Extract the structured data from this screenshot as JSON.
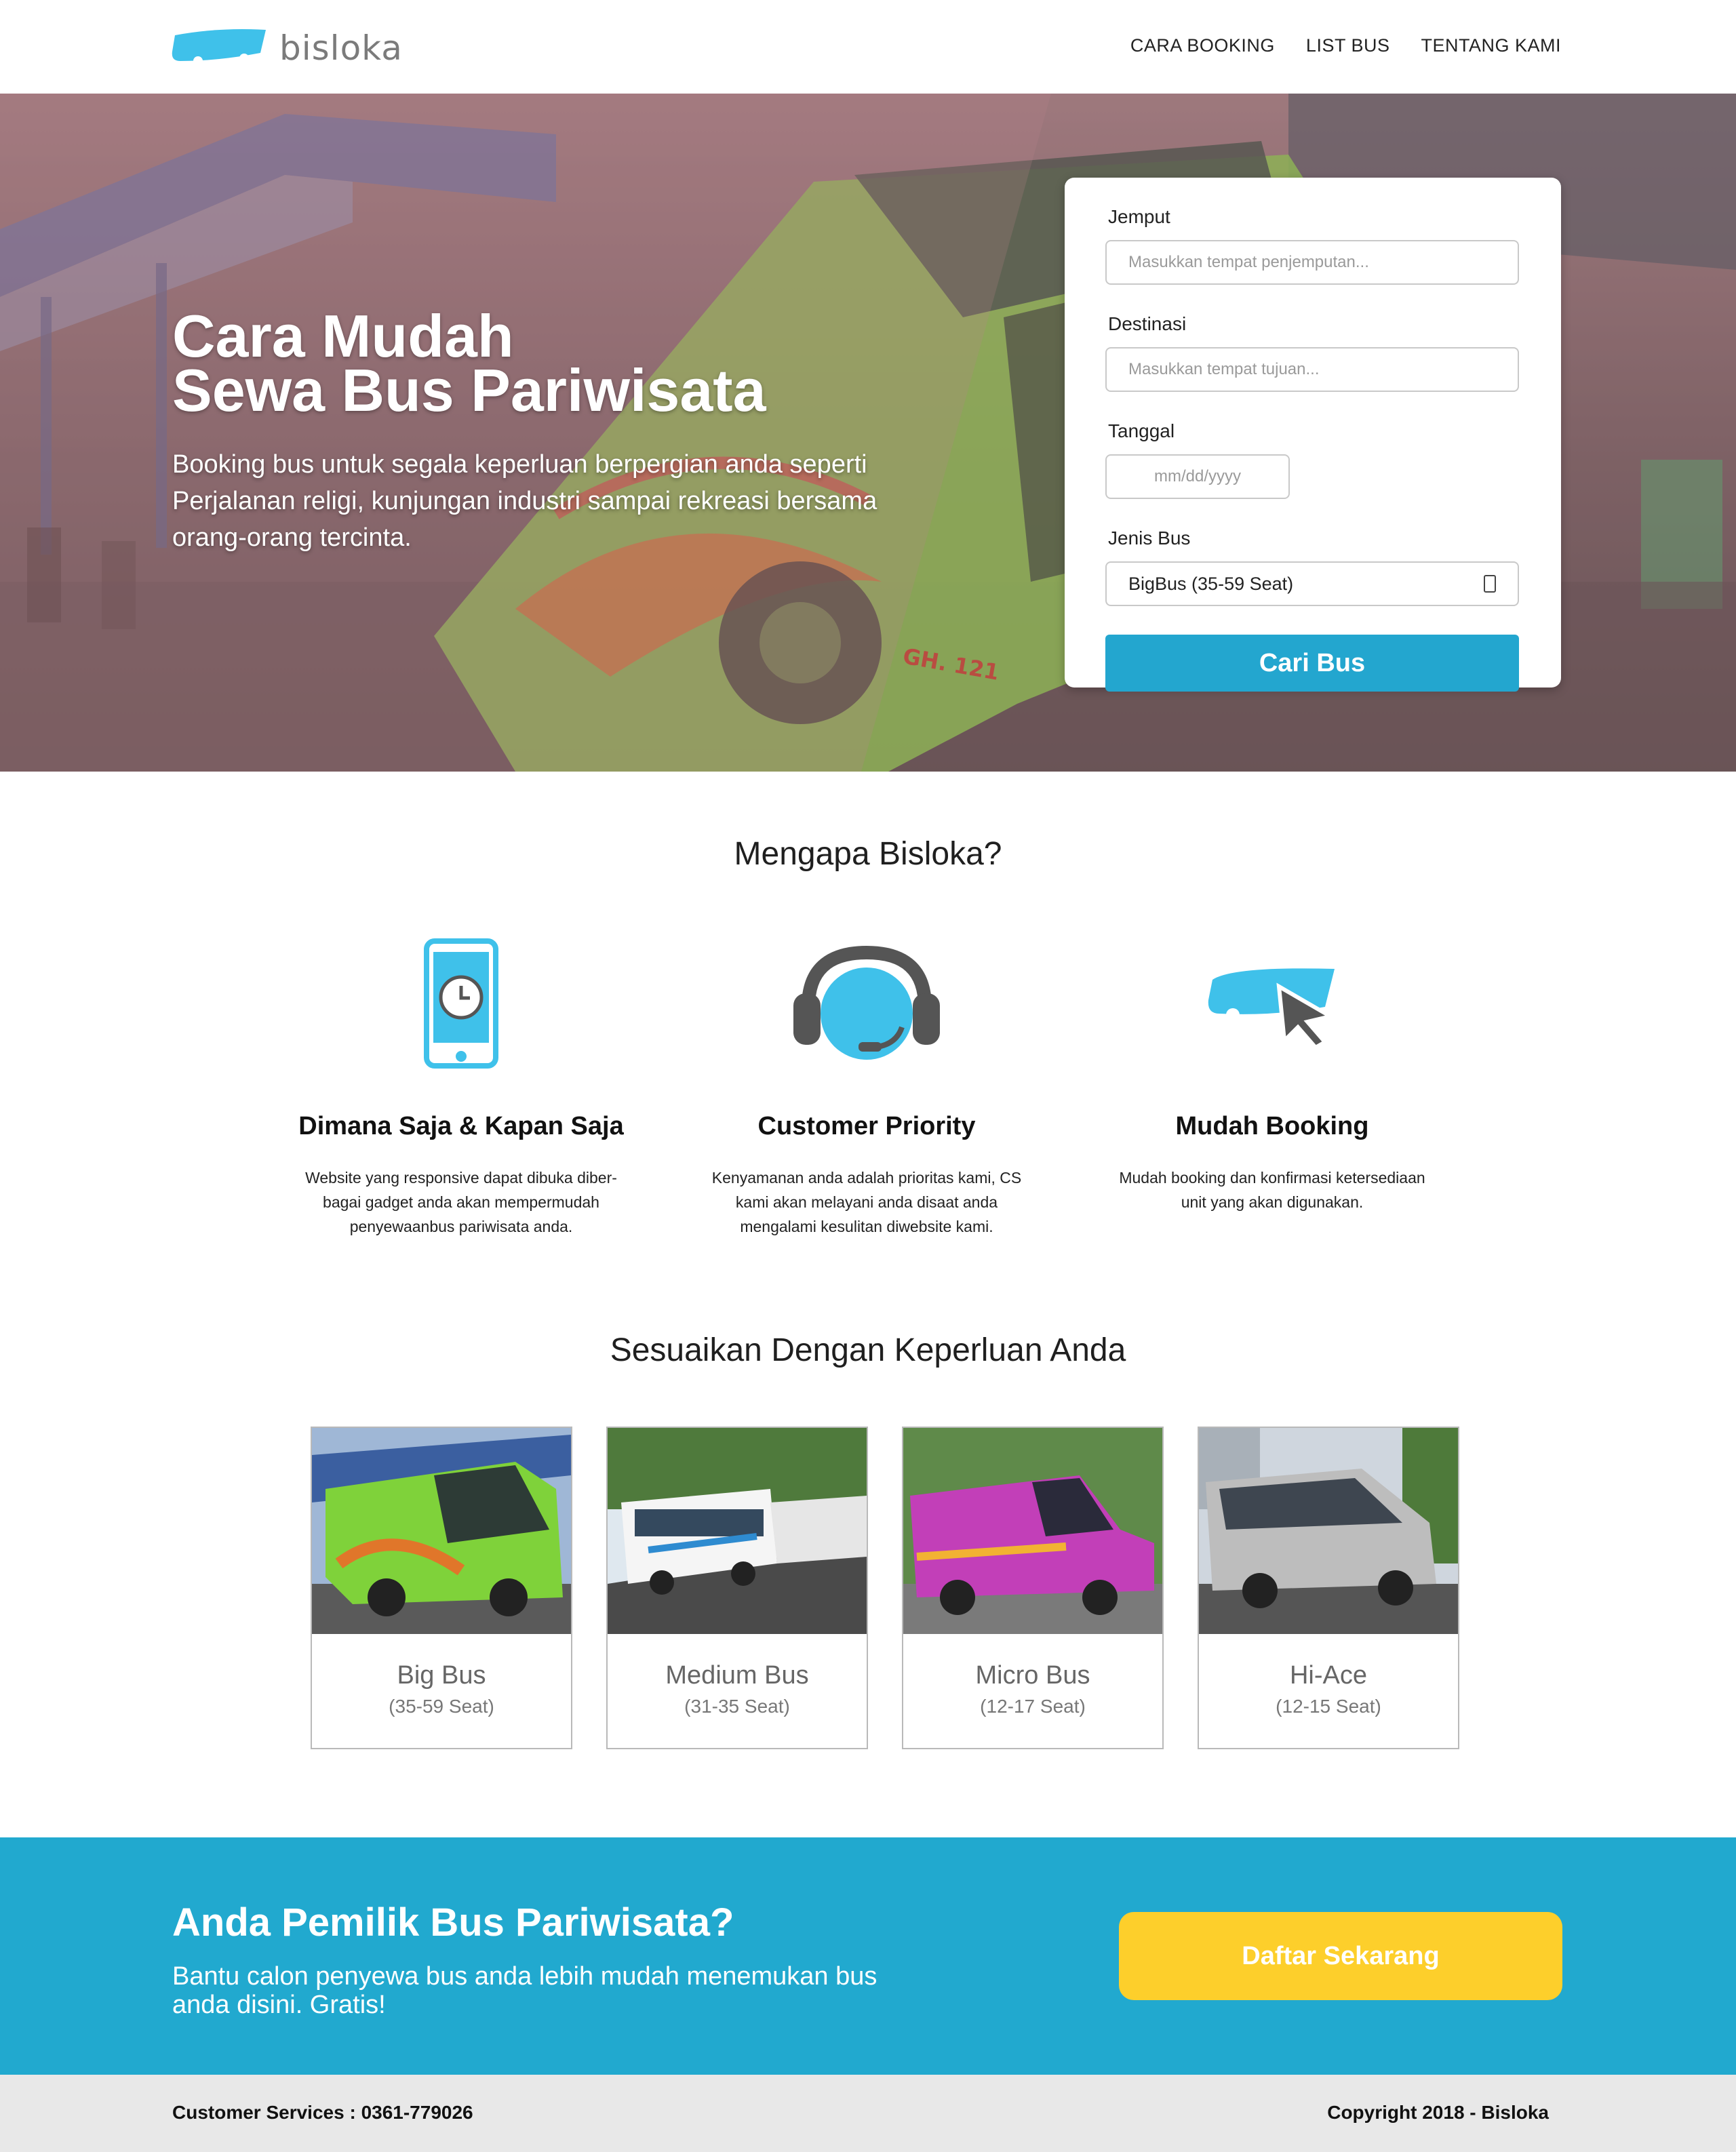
{
  "nav": {
    "logo_text": "bisloka",
    "links": [
      "CARA  BOOKING",
      "LIST BUS",
      "TENTANG KAMI"
    ]
  },
  "hero": {
    "title_line1": "Cara Mudah",
    "title_line2": "Sewa Bus Pariwisata",
    "subtitle": "Booking bus untuk segala keperluan berpergian anda seperti Perjalanan religi, kunjungan industri sampai rekreasi bersama orang-orang tercinta.",
    "bus_lettering": "GH. 121"
  },
  "form": {
    "pickup_label": "Jemput",
    "pickup_placeholder": "Masukkan tempat penjemputan...",
    "dest_label": "Destinasi",
    "dest_placeholder": "Masukkan tempat tujuan...",
    "date_label": "Tanggal",
    "date_placeholder": "mm/dd/yyyy",
    "bustype_label": "Jenis Bus",
    "bustype_value": "BigBus (35-59 Seat)",
    "submit_label": "Cari Bus"
  },
  "why": {
    "heading": "Mengapa Bisloka?",
    "features": [
      {
        "icon": "phone-clock-icon",
        "title": "Dimana Saja & Kapan Saja",
        "text": "Website yang responsive dapat dibuka diber-bagai gadget anda akan mempermudah penyewaanbus pariwisata anda."
      },
      {
        "icon": "headset-icon",
        "title": "Customer Priority",
        "text": "Kenyamanan anda adalah prioritas kami, CS kami akan melayani anda disaat anda mengalami kesulitan diwebsite kami."
      },
      {
        "icon": "bus-cursor-icon",
        "title": "Mudah Booking",
        "text": "Mudah booking dan konfirmasi ketersediaan unit yang akan digunakan."
      }
    ]
  },
  "buses": {
    "heading": "Sesuaikan Dengan Keperluan Anda",
    "items": [
      {
        "name": "Big Bus",
        "seat": "(35-59 Seat)",
        "color": "#7fd23a"
      },
      {
        "name": "Medium Bus",
        "seat": "(31-35 Seat)",
        "color": "#f2f2f2"
      },
      {
        "name": "Micro Bus",
        "seat": "(12-17 Seat)",
        "color": "#c23fb8"
      },
      {
        "name": "Hi-Ace",
        "seat": "(12-15 Seat)",
        "color": "#b9b9b9"
      }
    ]
  },
  "cta": {
    "heading": "Anda Pemilik Bus Pariwisata?",
    "text": "Bantu calon penyewa bus anda lebih mudah menemukan bus anda disini. Gratis!",
    "button": "Daftar Sekarang"
  },
  "footer": {
    "cs": "Customer Services : 0361-779026",
    "copyright": "Copyright 2018 - Bisloka"
  },
  "colors": {
    "brand": "#21a9cf",
    "accent": "#fdcf2b",
    "logo": "#3fc1ea"
  }
}
